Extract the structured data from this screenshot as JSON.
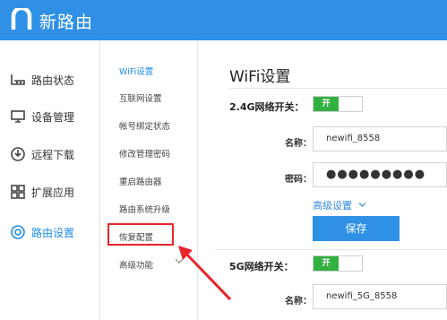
{
  "header": {
    "logo_text": "新路由"
  },
  "nav": {
    "items": [
      {
        "label": "路由状态",
        "icon": "router-icon"
      },
      {
        "label": "设备管理",
        "icon": "monitor-icon"
      },
      {
        "label": "远程下载",
        "icon": "download-icon"
      },
      {
        "label": "扩展应用",
        "icon": "apps-icon"
      },
      {
        "label": "路由设置",
        "icon": "settings-icon",
        "active": true
      }
    ]
  },
  "subnav": {
    "items": [
      {
        "label": "WiFi设置",
        "active": true
      },
      {
        "label": "互联网设置"
      },
      {
        "label": "帐号绑定状态"
      },
      {
        "label": "修改管理密码"
      },
      {
        "label": "重启路由器"
      },
      {
        "label": "路由系统升级"
      },
      {
        "label": "恢复配置",
        "highlighted": true
      },
      {
        "label": "高级功能",
        "icon": "chevron-down-icon"
      }
    ]
  },
  "main": {
    "title": "WiFi设置",
    "wifi24": {
      "label": "2.4G网络开关：",
      "toggle": "开",
      "name_label": "名称：",
      "name_value": "newifi_8558",
      "password_label": "密码：",
      "password_value": "●●●●●●●●●"
    },
    "advanced_label": "高级设置",
    "save_label": "保存",
    "wifi5": {
      "label": "5G网络开关：",
      "toggle": "开",
      "name_label": "名称：",
      "name_value": "newifi_5G_8558"
    }
  },
  "colors": {
    "header": "#2f90e6",
    "active_text": "#1e8ce8",
    "toggle_on": "#32b141",
    "highlight": "#e8232a"
  }
}
